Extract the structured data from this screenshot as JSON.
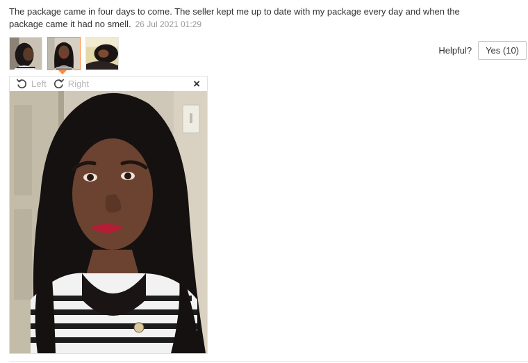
{
  "review": {
    "text": "The package came in four days to come. The seller kept me up to date with my package every day and when the package came it had no smell.",
    "date": "26 Jul 2021 01:29"
  },
  "thumbnails": [
    {
      "name": "photo-thumb-1",
      "active": false
    },
    {
      "name": "photo-thumb-2",
      "active": true
    },
    {
      "name": "photo-thumb-3",
      "active": false
    }
  ],
  "helpful": {
    "label": "Helpful?",
    "yes_label": "Yes (10)"
  },
  "viewer": {
    "rotate_left_label": "Left",
    "rotate_right_label": "Right",
    "close_glyph": "×",
    "icons": {
      "rotate_left": "rotate-left-icon",
      "rotate_right": "rotate-right-icon",
      "close": "close-icon"
    }
  },
  "colors": {
    "accent": "#ff8a3d",
    "date": "#999999",
    "text": "#333333",
    "toolbar_disabled": "#b8b8b8"
  }
}
